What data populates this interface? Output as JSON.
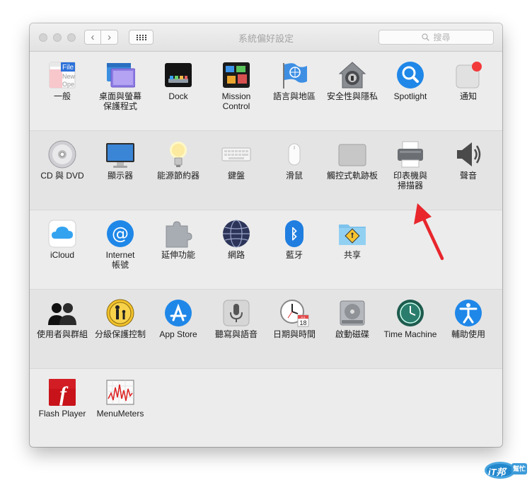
{
  "window": {
    "title": "系統偏好設定",
    "search_placeholder": "搜尋",
    "back_symbol": "‹",
    "forward_symbol": "›"
  },
  "sections": [
    {
      "items": [
        {
          "id": "general",
          "lines": [
            "一般"
          ],
          "icon": "file-general-icon",
          "file_tag": "File",
          "file_lines": [
            "New",
            "Ope"
          ]
        },
        {
          "id": "desktop",
          "lines": [
            "桌面與螢幕",
            "保護程式"
          ],
          "icon": "desktop-screensaver-icon"
        },
        {
          "id": "dock",
          "lines": [
            "Dock"
          ],
          "icon": "dock-icon"
        },
        {
          "id": "mission",
          "lines": [
            "Mission",
            "Control"
          ],
          "icon": "mission-control-icon"
        },
        {
          "id": "language",
          "lines": [
            "語言與地區"
          ],
          "icon": "un-flag-icon"
        },
        {
          "id": "security",
          "lines": [
            "安全性與隱私"
          ],
          "icon": "house-lock-icon"
        },
        {
          "id": "spotlight",
          "lines": [
            "Spotlight"
          ],
          "icon": "magnifier-icon"
        },
        {
          "id": "notifications",
          "lines": [
            "通知"
          ],
          "icon": "notifications-icon"
        }
      ]
    },
    {
      "items": [
        {
          "id": "cddvd",
          "lines": [
            "CD 與 DVD"
          ],
          "icon": "disc-icon"
        },
        {
          "id": "displays",
          "lines": [
            "顯示器"
          ],
          "icon": "monitor-icon"
        },
        {
          "id": "energy",
          "lines": [
            "能源節約器"
          ],
          "icon": "lightbulb-icon"
        },
        {
          "id": "keyboard",
          "lines": [
            "鍵盤"
          ],
          "icon": "keyboard-icon"
        },
        {
          "id": "mouse",
          "lines": [
            "滑鼠"
          ],
          "icon": "mouse-icon"
        },
        {
          "id": "trackpad",
          "lines": [
            "觸控式軌跡板"
          ],
          "icon": "trackpad-icon"
        },
        {
          "id": "printers",
          "lines": [
            "印表機與",
            "掃描器"
          ],
          "icon": "printer-icon"
        },
        {
          "id": "sound",
          "lines": [
            "聲音"
          ],
          "icon": "speaker-icon"
        }
      ]
    },
    {
      "items": [
        {
          "id": "icloud",
          "lines": [
            "iCloud"
          ],
          "icon": "cloud-icon"
        },
        {
          "id": "internet",
          "lines": [
            "Internet",
            "帳號"
          ],
          "icon": "at-sign-icon",
          "glyph": "@"
        },
        {
          "id": "extensions",
          "lines": [
            "延伸功能"
          ],
          "icon": "puzzle-icon"
        },
        {
          "id": "network",
          "lines": [
            "網路"
          ],
          "icon": "globe-icon"
        },
        {
          "id": "bluetooth",
          "lines": [
            "藍牙"
          ],
          "icon": "bluetooth-icon",
          "glyph": "ᛒ"
        },
        {
          "id": "sharing",
          "lines": [
            "共享"
          ],
          "icon": "shared-folder-icon"
        }
      ]
    },
    {
      "items": [
        {
          "id": "users",
          "lines": [
            "使用者與群組"
          ],
          "icon": "users-icon"
        },
        {
          "id": "parental",
          "lines": [
            "分級保護控制"
          ],
          "icon": "parental-icon"
        },
        {
          "id": "appstore",
          "lines": [
            "App Store"
          ],
          "icon": "app-store-icon"
        },
        {
          "id": "dictation",
          "lines": [
            "聽寫與語音"
          ],
          "icon": "microphone-icon"
        },
        {
          "id": "datetime",
          "lines": [
            "日期與時間"
          ],
          "icon": "clock-calendar-icon",
          "cal_month": "JUL",
          "cal_day": "18"
        },
        {
          "id": "startup",
          "lines": [
            "啟動磁碟"
          ],
          "icon": "hard-disk-icon"
        },
        {
          "id": "timemachine",
          "lines": [
            "Time Machine"
          ],
          "icon": "time-machine-icon"
        },
        {
          "id": "accessibility",
          "lines": [
            "輔助使用"
          ],
          "icon": "accessibility-icon"
        }
      ]
    },
    {
      "items": [
        {
          "id": "flash",
          "lines": [
            "Flash Player"
          ],
          "icon": "flash-icon",
          "glyph": "f"
        },
        {
          "id": "menumeters",
          "lines": [
            "MenuMeters"
          ],
          "icon": "menumeters-icon"
        }
      ]
    }
  ],
  "watermark": {
    "text": "iT邦",
    "subtext": "幫忙"
  },
  "colors": {
    "accent_blue": "#1f87e8",
    "arrow_red": "#e8262c",
    "notification_red": "#f23a3a",
    "flash_red": "#c8131a"
  }
}
